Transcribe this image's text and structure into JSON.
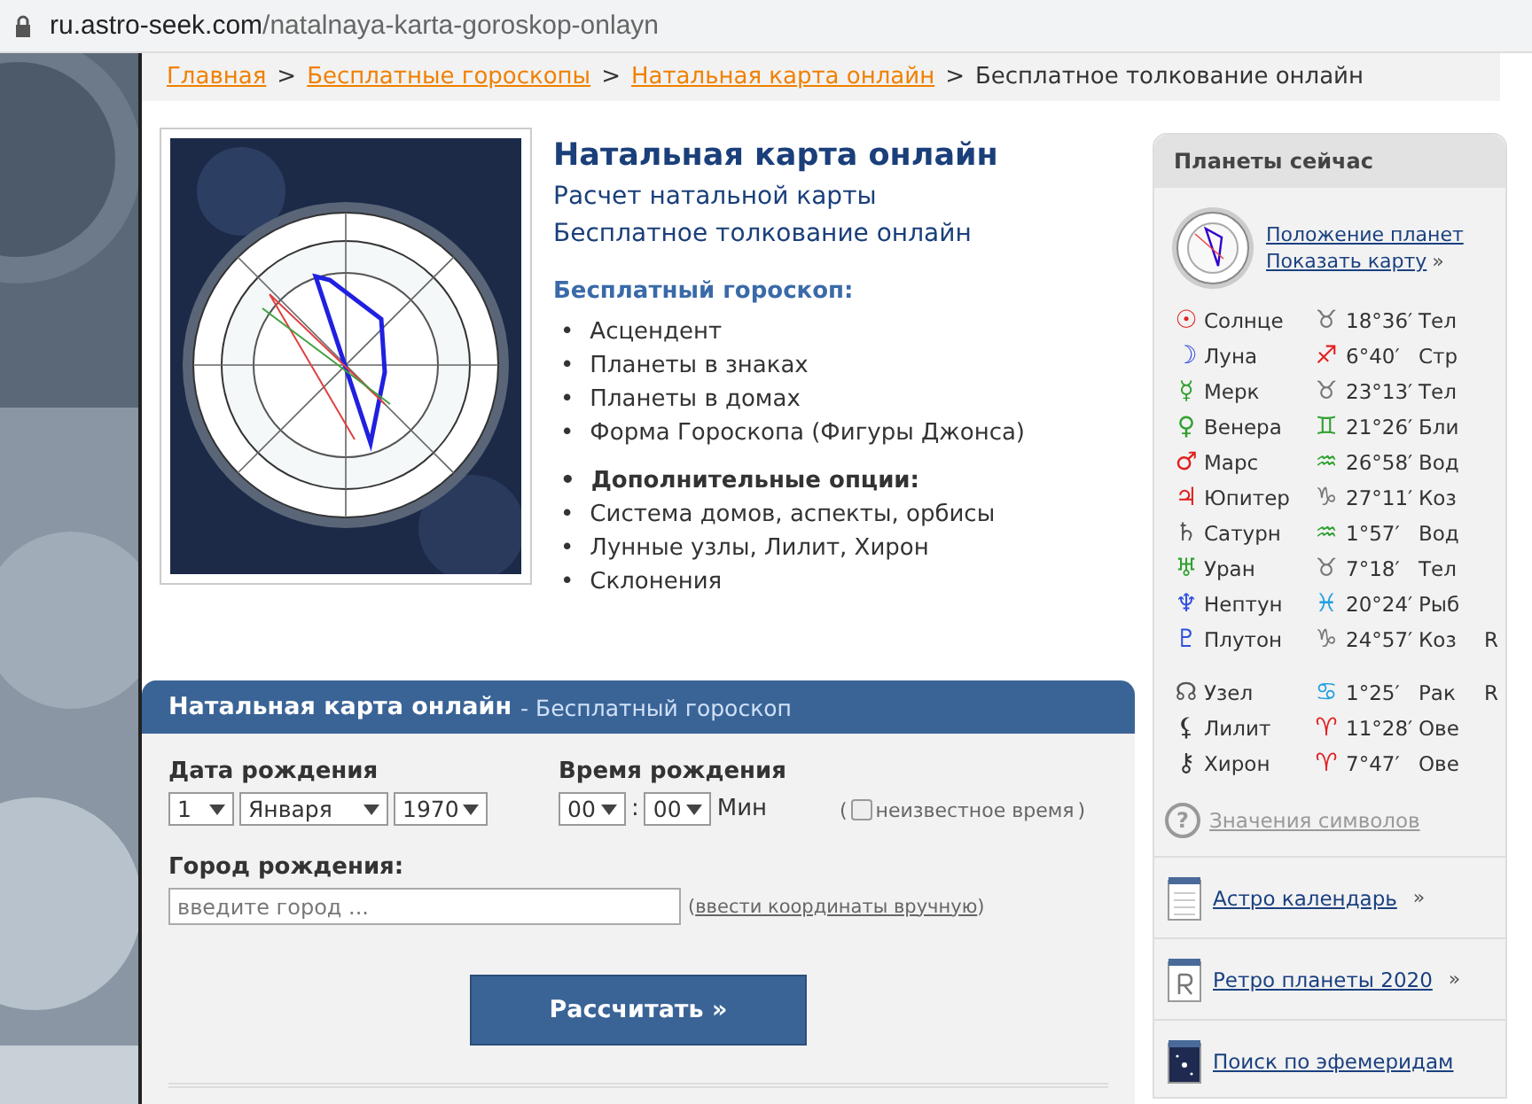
{
  "address_bar": {
    "host": "ru.astro-seek.com",
    "path": "/natalnaya-karta-goroskop-onlayn"
  },
  "breadcrumbs": [
    {
      "label": "Главная",
      "link": true
    },
    {
      "label": "Бесплатные гороскопы",
      "link": true
    },
    {
      "label": "Натальная карта онлайн",
      "link": true
    },
    {
      "label": "Бесплатное толкование онлайн",
      "link": false
    }
  ],
  "breadcrumb_separator": ">",
  "intro": {
    "title": "Натальная карта онлайн",
    "subtitles": [
      "Расчет натальной карты",
      "Бесплатное толкование онлайн"
    ],
    "section_title": "Бесплатный гороскоп:",
    "lists": [
      [
        {
          "kind": "item",
          "bullet": "•",
          "text": "Асцендент"
        },
        {
          "kind": "item",
          "bullet": "•",
          "text": "Планеты в знаках"
        },
        {
          "kind": "item",
          "bullet": "•",
          "text": "Планеты в домах"
        },
        {
          "kind": "item",
          "bullet": "•",
          "text": "Форма Гороскопа (Фигуры Джонса)"
        }
      ],
      [
        {
          "kind": "heading",
          "bullet": "•",
          "text": "Дополнительные опции:"
        },
        {
          "kind": "item",
          "bullet": "•",
          "text": "Система домов, аспекты, орбисы"
        },
        {
          "kind": "item",
          "bullet": "•",
          "text": "Лунные узлы, Лилит, Хирон"
        },
        {
          "kind": "item",
          "bullet": "•",
          "text": "Склонения"
        }
      ]
    ]
  },
  "form": {
    "title": "Натальная карта онлайн",
    "subtitle": "- Бесплатный гороскоп",
    "date_label": "Дата рождения",
    "day": "1",
    "month": "Января",
    "year": "1970",
    "time_label": "Время рождения",
    "hour": "00",
    "time_separator": ":",
    "minute": "00",
    "minute_unit": "Мин",
    "unknown_time": {
      "bracket_open": "(",
      "label": "неизвестное время",
      "bracket_close": ")",
      "checked": false
    },
    "city_label": "Город рождения:",
    "city_placeholder": "введите город ...",
    "manual": {
      "bracket_open": "(",
      "link": "ввести координаты вручную",
      "bracket_close": ")"
    },
    "submit": "Рассчитать »"
  },
  "sidebar": {
    "title": "Планеты сейчас",
    "links": [
      "Положение планет",
      "Показать карту"
    ],
    "more": "»",
    "planets": [
      {
        "symbol": "☉",
        "color": "#e02020",
        "name": "Солнце",
        "sign": {
          "symbol": "♉",
          "color": "#777777",
          "degree": "18°36′",
          "name": "Тел"
        }
      },
      {
        "symbol": "☽",
        "color": "#3050e0",
        "name": "Луна",
        "sign": {
          "symbol": "♐",
          "color": "#e02020",
          "degree": "6°40′",
          "name": "Стр"
        }
      },
      {
        "symbol": "☿",
        "color": "#30a030",
        "name": "Мерк",
        "sign": {
          "symbol": "♉",
          "color": "#777777",
          "degree": "23°13′",
          "name": "Тел"
        }
      },
      {
        "symbol": "♀",
        "color": "#30a030",
        "name": "Венера",
        "sign": {
          "symbol": "♊",
          "color": "#30a030",
          "degree": "21°26′",
          "name": "Бли"
        }
      },
      {
        "symbol": "♂",
        "color": "#e02020",
        "name": "Марс",
        "sign": {
          "symbol": "♒",
          "color": "#30a030",
          "degree": "26°58′",
          "name": "Вод"
        }
      },
      {
        "symbol": "♃",
        "color": "#e02020",
        "name": "Юпитер",
        "sign": {
          "symbol": "♑",
          "color": "#777777",
          "degree": "27°11′",
          "name": "Коз"
        }
      },
      {
        "symbol": "♄",
        "color": "#555555",
        "name": "Сатурн",
        "sign": {
          "symbol": "♒",
          "color": "#30a030",
          "degree": "1°57′",
          "name": "Вод"
        }
      },
      {
        "symbol": "♅",
        "color": "#30a030",
        "name": "Уран",
        "sign": {
          "symbol": "♉",
          "color": "#777777",
          "degree": "7°18′",
          "name": "Тел"
        }
      },
      {
        "symbol": "♆",
        "color": "#3050e0",
        "name": "Нептун",
        "sign": {
          "symbol": "♓",
          "color": "#20a0e0",
          "degree": "20°24′",
          "name": "Рыб"
        }
      },
      {
        "symbol": "♇",
        "color": "#3050e0",
        "name": "Плутон",
        "sign": {
          "symbol": "♑",
          "color": "#777777",
          "degree": "24°57′",
          "name": "Коз"
        },
        "retro": "R"
      }
    ],
    "points": [
      {
        "symbol": "☊",
        "color": "#555555",
        "name": "Узел",
        "sign": {
          "symbol": "♋",
          "color": "#20a0e0",
          "degree": "1°25′",
          "name": "Рак"
        },
        "retro": "R"
      },
      {
        "symbol": "⚸",
        "color": "#333333",
        "name": "Лилит",
        "sign": {
          "symbol": "♈",
          "color": "#e02020",
          "degree": "11°28′",
          "name": "Ове"
        }
      },
      {
        "symbol": "⚷",
        "color": "#333333",
        "name": "Хирон",
        "sign": {
          "symbol": "♈",
          "color": "#e02020",
          "degree": "7°47′",
          "name": "Ове"
        }
      }
    ],
    "help": {
      "icon": "?",
      "label": "Значения символов"
    },
    "extra_links": [
      {
        "kind": "calendar",
        "label": "Астро календарь",
        "more": "»"
      },
      {
        "kind": "retro",
        "label": "Ретро планеты 2020",
        "more": "»"
      },
      {
        "kind": "ephemeris",
        "label": "Поиск по эфемеридам"
      }
    ]
  }
}
